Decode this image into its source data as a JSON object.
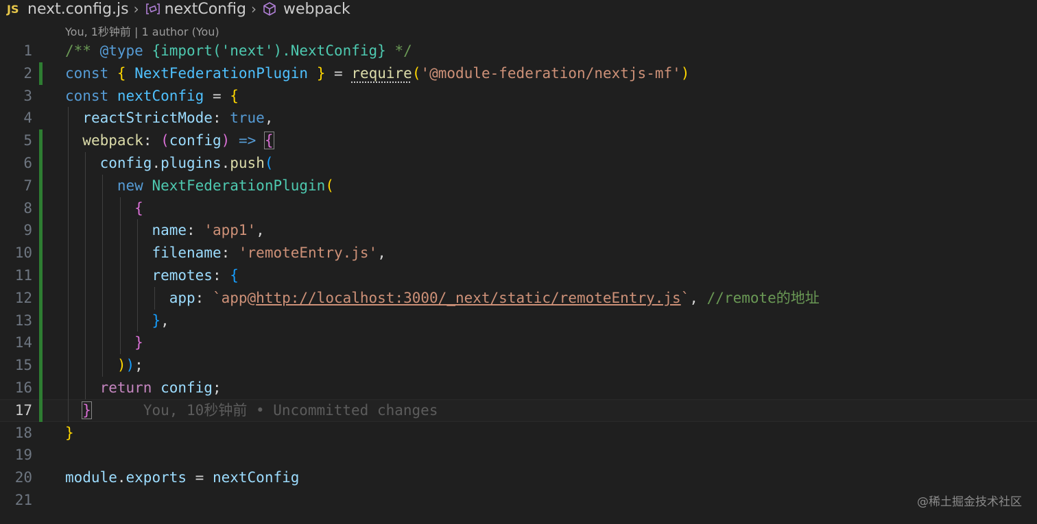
{
  "breadcrumb": {
    "file_icon": "JS",
    "file": "next.config.js",
    "variable": "nextConfig",
    "property": "webpack"
  },
  "codelens": "You, 1秒钟前 | 1 author (You)",
  "lines": [
    {
      "n": "1",
      "tokens": [
        [
          "t-comment",
          "/** "
        ],
        [
          "t-doctag",
          "@type"
        ],
        [
          "t-comment",
          " "
        ],
        [
          "t-type",
          "{import('next').NextConfig}"
        ],
        [
          "t-comment",
          " */"
        ]
      ]
    },
    {
      "n": "2",
      "modified": true,
      "tokens": [
        [
          "t-kw",
          "const"
        ],
        [
          "t-punc",
          " "
        ],
        [
          "t-b1",
          "{"
        ],
        [
          "t-punc",
          " "
        ],
        [
          "t-const",
          "NextFederationPlugin"
        ],
        [
          "t-punc",
          " "
        ],
        [
          "t-b1",
          "}"
        ],
        [
          "t-punc",
          " = "
        ],
        [
          "t-fn dotted",
          "require"
        ],
        [
          "t-b1",
          "("
        ],
        [
          "t-str",
          "'@module-federation/nextjs-mf'"
        ],
        [
          "t-b1",
          ")"
        ]
      ]
    },
    {
      "n": "3",
      "tokens": [
        [
          "t-kw",
          "const"
        ],
        [
          "t-punc",
          " "
        ],
        [
          "t-const",
          "nextConfig"
        ],
        [
          "t-punc",
          " = "
        ],
        [
          "t-b1",
          "{"
        ]
      ]
    },
    {
      "n": "4",
      "tokens": [
        [
          "t-punc",
          "  "
        ],
        [
          "t-var",
          "reactStrictMode"
        ],
        [
          "t-punc",
          ": "
        ],
        [
          "t-bool",
          "true"
        ],
        [
          "t-punc",
          ","
        ]
      ]
    },
    {
      "n": "5",
      "modified": true,
      "tokens": [
        [
          "t-punc",
          "  "
        ],
        [
          "t-fn",
          "webpack"
        ],
        [
          "t-punc",
          ": "
        ],
        [
          "t-b2",
          "("
        ],
        [
          "t-var",
          "config"
        ],
        [
          "t-b2",
          ")"
        ],
        [
          "t-punc",
          " "
        ],
        [
          "t-kw",
          "=>"
        ],
        [
          "t-punc",
          " "
        ],
        [
          "t-b2 bracket-box",
          "{"
        ]
      ]
    },
    {
      "n": "6",
      "modified": true,
      "tokens": [
        [
          "t-punc",
          "    "
        ],
        [
          "t-var",
          "config"
        ],
        [
          "t-punc",
          "."
        ],
        [
          "t-var",
          "plugins"
        ],
        [
          "t-punc",
          "."
        ],
        [
          "t-fn",
          "push"
        ],
        [
          "t-b3",
          "("
        ]
      ]
    },
    {
      "n": "7",
      "modified": true,
      "tokens": [
        [
          "t-punc",
          "      "
        ],
        [
          "t-kw",
          "new"
        ],
        [
          "t-punc",
          " "
        ],
        [
          "t-type",
          "NextFederationPlugin"
        ],
        [
          "t-b1",
          "("
        ]
      ]
    },
    {
      "n": "8",
      "modified": true,
      "tokens": [
        [
          "t-punc",
          "        "
        ],
        [
          "t-b2",
          "{"
        ]
      ]
    },
    {
      "n": "9",
      "modified": true,
      "tokens": [
        [
          "t-punc",
          "          "
        ],
        [
          "t-var",
          "name"
        ],
        [
          "t-punc",
          ": "
        ],
        [
          "t-str",
          "'app1'"
        ],
        [
          "t-punc",
          ","
        ]
      ]
    },
    {
      "n": "10",
      "modified": true,
      "tokens": [
        [
          "t-punc",
          "          "
        ],
        [
          "t-var",
          "filename"
        ],
        [
          "t-punc",
          ": "
        ],
        [
          "t-str",
          "'remoteEntry.js'"
        ],
        [
          "t-punc",
          ","
        ]
      ]
    },
    {
      "n": "11",
      "modified": true,
      "tokens": [
        [
          "t-punc",
          "          "
        ],
        [
          "t-var",
          "remotes"
        ],
        [
          "t-punc",
          ": "
        ],
        [
          "t-b3",
          "{"
        ]
      ]
    },
    {
      "n": "12",
      "modified": true,
      "tokens": [
        [
          "t-punc",
          "            "
        ],
        [
          "t-var",
          "app"
        ],
        [
          "t-punc",
          ": "
        ],
        [
          "t-str",
          "`app@"
        ],
        [
          "t-url",
          "http://localhost:3000/_next/static/remoteEntry.js"
        ],
        [
          "t-str",
          "`"
        ],
        [
          "t-punc",
          ", "
        ],
        [
          "t-comment",
          "//remote的地址"
        ]
      ]
    },
    {
      "n": "13",
      "modified": true,
      "tokens": [
        [
          "t-punc",
          "          "
        ],
        [
          "t-b3",
          "}"
        ],
        [
          "t-punc",
          ","
        ]
      ]
    },
    {
      "n": "14",
      "modified": true,
      "tokens": [
        [
          "t-punc",
          "        "
        ],
        [
          "t-b2",
          "}"
        ]
      ]
    },
    {
      "n": "15",
      "modified": true,
      "tokens": [
        [
          "t-punc",
          "      "
        ],
        [
          "t-b1",
          ")"
        ],
        [
          "t-b3",
          ")"
        ],
        [
          "t-punc",
          ";"
        ]
      ]
    },
    {
      "n": "16",
      "modified": true,
      "tokens": [
        [
          "t-punc",
          "    "
        ],
        [
          "t-kw2",
          "return"
        ],
        [
          "t-punc",
          " "
        ],
        [
          "t-var",
          "config"
        ],
        [
          "t-punc",
          ";"
        ]
      ]
    },
    {
      "n": "17",
      "modified": true,
      "current": true,
      "tokens": [
        [
          "t-punc",
          "  "
        ],
        [
          "t-b2 bracket-box",
          "}"
        ],
        [
          "t-punc",
          "      "
        ],
        [
          "t-blame",
          "You, 10秒钟前 • Uncommitted changes"
        ]
      ]
    },
    {
      "n": "18",
      "tokens": [
        [
          "t-b1",
          "}"
        ]
      ]
    },
    {
      "n": "19",
      "tokens": []
    },
    {
      "n": "20",
      "tokens": [
        [
          "t-var",
          "module"
        ],
        [
          "t-punc",
          "."
        ],
        [
          "t-var",
          "exports"
        ],
        [
          "t-punc",
          " = "
        ],
        [
          "t-var",
          "nextConfig"
        ]
      ]
    },
    {
      "n": "21",
      "tokens": []
    }
  ],
  "watermark": "@稀土掘金技术社区",
  "colors": {
    "background": "#1f1f1f",
    "gutter_modified": "#2e7d32",
    "line_number": "#6e7681"
  }
}
